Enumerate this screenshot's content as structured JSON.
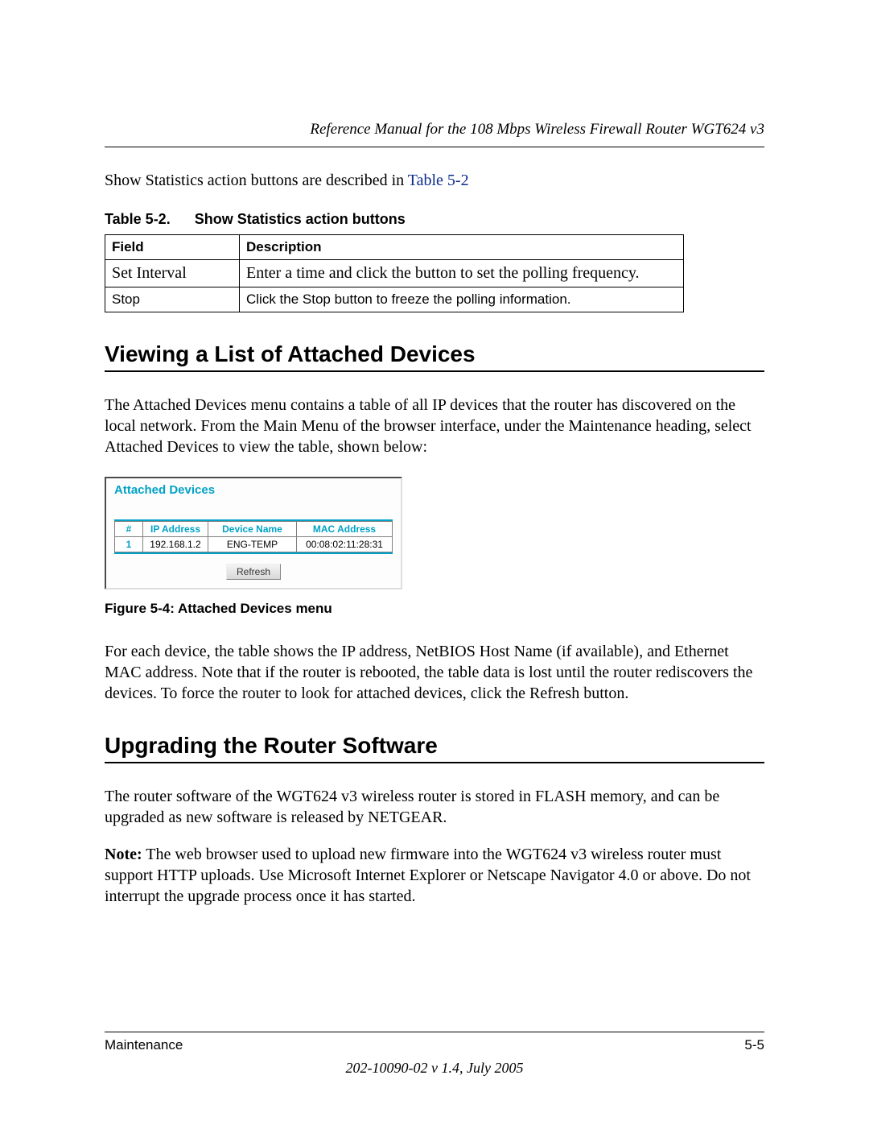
{
  "header": {
    "title": "Reference Manual for the 108 Mbps Wireless Firewall Router WGT624 v3"
  },
  "intro": {
    "prefix": "Show Statistics action buttons are described in ",
    "link": "Table 5-2"
  },
  "table52": {
    "caption_num": "Table 5-2.",
    "caption_title": "Show Statistics action buttons",
    "headers": {
      "field": "Field",
      "description": "Description"
    },
    "rows": [
      {
        "field": "Set Interval",
        "description": "Enter a time and click the button to set the polling frequency."
      },
      {
        "field": "Stop",
        "description": "Click the Stop button to freeze the polling information."
      }
    ]
  },
  "section1": {
    "heading": "Viewing a List of Attached Devices",
    "para1": "The Attached Devices menu contains a table of all IP devices that the router has discovered on the local network. From the Main Menu of the browser interface, under the Maintenance heading, select Attached Devices to view the table, shown below:",
    "screenshot": {
      "title": "Attached Devices",
      "headers": {
        "num": "#",
        "ip": "IP Address",
        "name": "Device Name",
        "mac": "MAC Address"
      },
      "rows": [
        {
          "num": "1",
          "ip": "192.168.1.2",
          "name": "ENG-TEMP",
          "mac": "00:08:02:11:28:31"
        }
      ],
      "refresh": "Refresh"
    },
    "figure_caption": "Figure 5-4:  Attached Devices menu",
    "para2": "For each device, the table shows the IP address, NetBIOS Host Name (if available), and Ethernet MAC address. Note that if the router is rebooted, the table data is lost until the router rediscovers the devices. To force the router to look for attached devices, click the Refresh button."
  },
  "section2": {
    "heading": "Upgrading the Router Software",
    "para1": "The router software of the WGT624 v3 wireless router is stored in FLASH memory, and can be upgraded as new software is released by NETGEAR.",
    "note_label": "Note:",
    "para2": " The web browser used to upload new firmware into the WGT624 v3 wireless router must support HTTP uploads. Use Microsoft Internet Explorer or Netscape Navigator 4.0 or above. Do not interrupt the upgrade process once it has started."
  },
  "footer": {
    "left": "Maintenance",
    "right": "5-5",
    "docid": "202-10090-02 v 1.4, July 2005"
  }
}
